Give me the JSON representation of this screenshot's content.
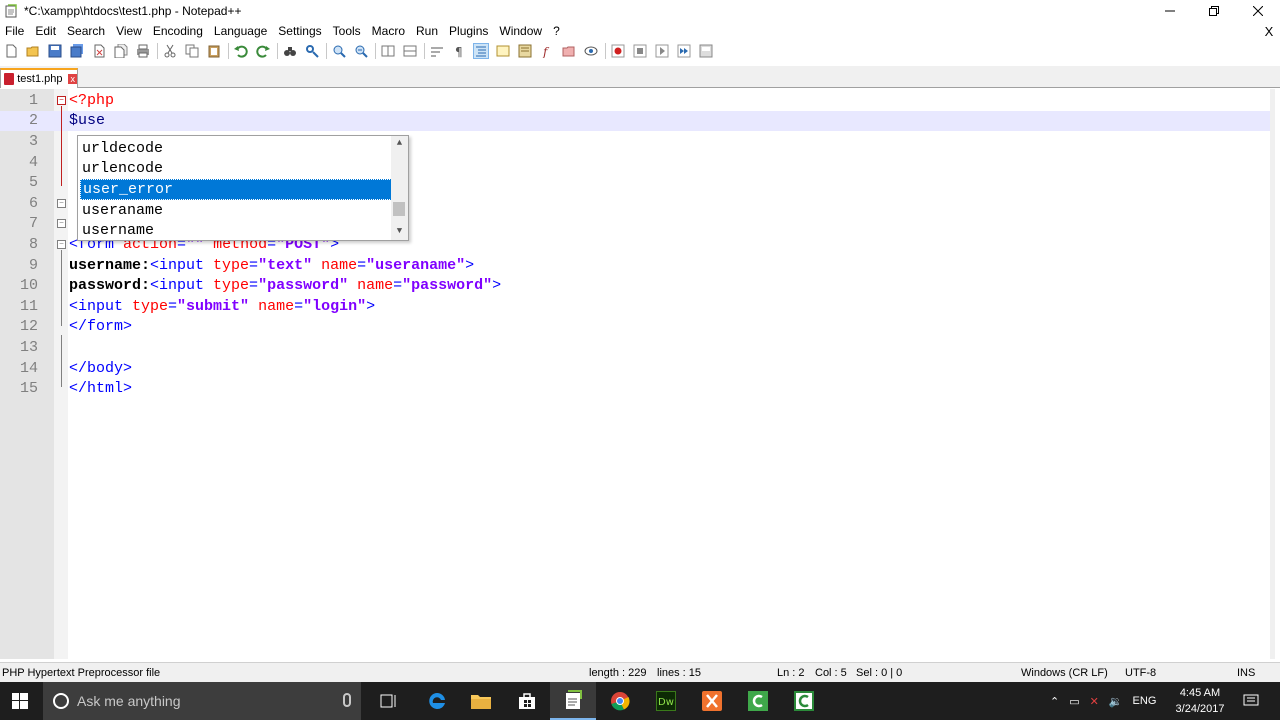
{
  "window": {
    "title": "*C:\\xampp\\htdocs\\test1.php - Notepad++",
    "minimize": "—",
    "restore": "❐",
    "close": "✕"
  },
  "menu": {
    "items": [
      "File",
      "Edit",
      "Search",
      "View",
      "Encoding",
      "Language",
      "Settings",
      "Tools",
      "Macro",
      "Run",
      "Plugins",
      "Window",
      "?"
    ],
    "close": "X"
  },
  "tab": {
    "label": "test1.php",
    "close": "x"
  },
  "editor": {
    "line_numbers": [
      "1",
      "2",
      "3",
      "4",
      "5",
      "6",
      "7",
      "8",
      "9",
      "10",
      "11",
      "12",
      "13",
      "14",
      "15"
    ],
    "current_line": 2,
    "lines": {
      "l1": "<?php",
      "l2": "$use",
      "l8_tag": "<form ",
      "l8_a1": "action",
      "l8_eq1": "=",
      "l8_v1": "\"\"",
      "l8_a2": " method",
      "l8_eq2": "=",
      "l8_v2": "\"POST\"",
      "l8_end": ">",
      "l9_text": "username:",
      "l9_tag": "<input ",
      "l9_a1": "type",
      "l9_v1": "\"text\"",
      "l9_a2": " name",
      "l9_v2": "\"useraname\"",
      "l9_end": ">",
      "l10_text": "password:",
      "l10_tag": "<input ",
      "l10_a1": "type",
      "l10_v1": "\"password\"",
      "l10_a2": " name",
      "l10_v2": "\"password\"",
      "l10_end": ">",
      "l11_tag": "<input ",
      "l11_a1": "type",
      "l11_v1": "\"submit\"",
      "l11_a2": " name",
      "l11_v2": "\"login\"",
      "l11_end": ">",
      "l12": "</form>",
      "l14": "</body>",
      "l15": "</html>"
    }
  },
  "autocomplete": {
    "items": [
      "urldecode",
      "urlencode",
      "user_error",
      "useraname",
      "username"
    ],
    "selected": "user_error"
  },
  "statusbar": {
    "filetype": "PHP Hypertext Preprocessor file",
    "length": "length : 229",
    "lines": "lines : 15",
    "ln": "Ln : 2",
    "col": "Col : 5",
    "sel": "Sel : 0 | 0",
    "eol": "Windows (CR LF)",
    "encoding": "UTF-8",
    "mode": "INS"
  },
  "taskbar": {
    "search_placeholder": "Ask me anything",
    "language": "ENG",
    "time": "4:45 AM",
    "date": "3/24/2017"
  },
  "colors": {
    "selection": "#0078d7",
    "current_line": "#e8e8ff",
    "tab_accent": "#f7a41d",
    "taskbar": "#1e1e1e"
  }
}
